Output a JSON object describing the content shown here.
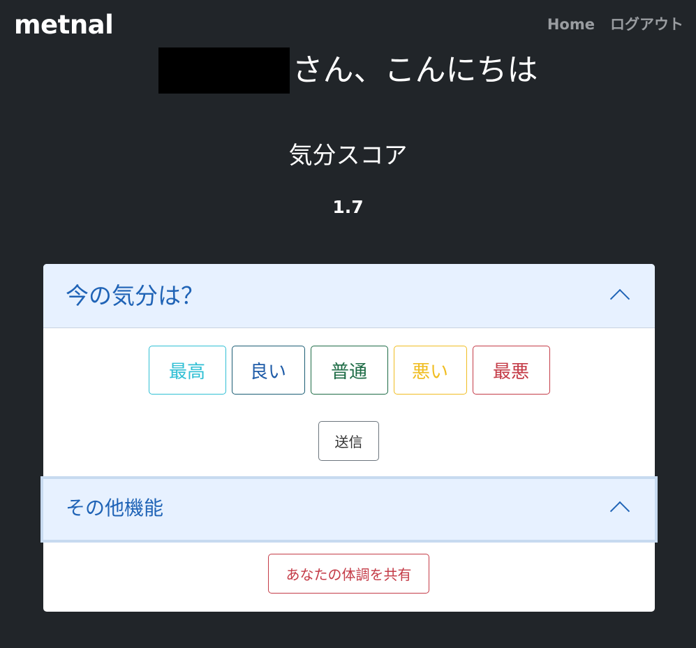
{
  "nav": {
    "brand": "metnal",
    "links": [
      "Home",
      "ログアウト"
    ]
  },
  "greeting": {
    "suffix": "さん、こんにちは"
  },
  "score": {
    "label": "気分スコア",
    "value": "1.7"
  },
  "mood_section": {
    "title": "今の気分は？",
    "options": [
      "最高",
      "良い",
      "普通",
      "悪い",
      "最悪"
    ],
    "submit_label": "送信"
  },
  "other_section": {
    "title": "その他機能",
    "share_label": "あなたの体調を共有"
  },
  "colors": {
    "background": "#212529",
    "accordion_bg": "#e7f1ff",
    "accordion_text": "#1f63b6",
    "mood_best": "#2fbfd4",
    "mood_good": "#1f5ca8",
    "mood_normal": "#1d6b45",
    "mood_bad": "#f0bd22",
    "mood_worst": "#c43b47"
  }
}
